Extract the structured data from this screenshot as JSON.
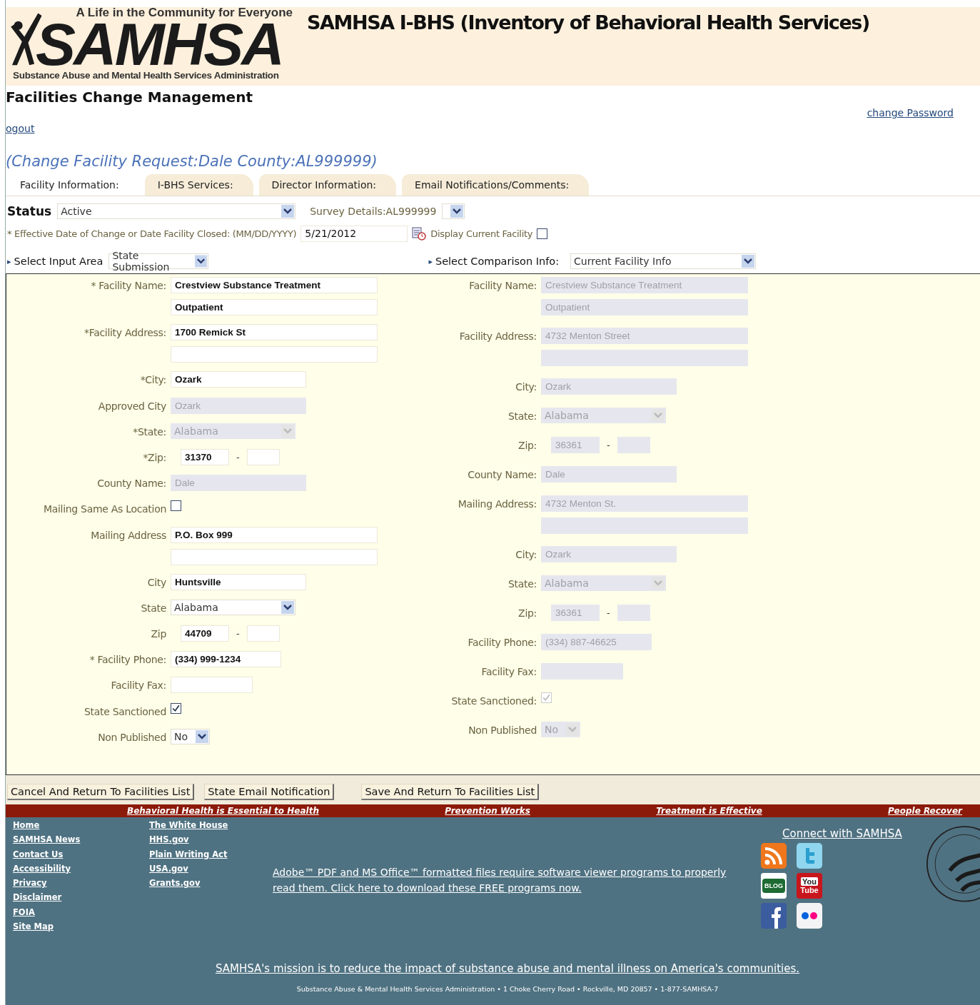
{
  "logo": {
    "tagline": "A Life in the Community for Everyone",
    "wordmark": "SAMHSA",
    "subtitle": "Substance Abuse and Mental Health Services Administration"
  },
  "site_title": "SAMHSA I-BHS (Inventory of Behavioral Health Services)",
  "page_title": "Facilities Change Management",
  "change_password": "change Password",
  "logout": "ogout",
  "request_title": "(Change Facility Request:Dale County:AL999999)",
  "tabs": [
    {
      "label": "Facility Information:",
      "selected": true
    },
    {
      "label": "I-BHS Services:",
      "selected": false
    },
    {
      "label": "Director Information:",
      "selected": false
    },
    {
      "label": "Email Notifications/Comments:",
      "selected": false
    }
  ],
  "status": {
    "label": "Status",
    "value": "Active",
    "survey_label": "Survey Details:AL999999"
  },
  "effective_date": {
    "label": "* Effective Date of Change or Date Facility Closed: (MM/DD/YYYY)",
    "value": "5/21/2012",
    "display_label": "Display Current Facility",
    "display_checked": false
  },
  "input_area": {
    "marker": "▸",
    "label": "Select Input Area",
    "value": "State Submission"
  },
  "comparison": {
    "marker": "▸",
    "label": "Select Comparison Info:",
    "value": "Current Facility Info"
  },
  "form": {
    "columns": [
      {
        "rows": [
          {
            "kind": "wide",
            "label": "* Facility Name:",
            "value": "Crestview Substance Treatment",
            "value_2": "Outpatient",
            "disabled": false
          },
          {
            "kind": "wide",
            "label": "*Facility Address:",
            "value": "1700 Remick St",
            "extra_line": true,
            "disabled": false
          },
          {
            "kind": "medium",
            "label": "*City:",
            "value": "Ozark",
            "disabled": false
          },
          {
            "kind": "medium",
            "label": "Approved City",
            "value": "Ozark",
            "disabled": true
          },
          {
            "kind": "select",
            "label": "*State:",
            "value": "Alabama",
            "disabled": true
          },
          {
            "kind": "zip",
            "label": "*Zip:",
            "value": "31370",
            "separator": "-",
            "disabled": false
          },
          {
            "kind": "medium",
            "label": "County Name:",
            "value": "Dale",
            "disabled": true
          },
          {
            "kind": "checkbox",
            "label": "Mailing Same As Location",
            "checked": false,
            "disabled": false
          },
          {
            "kind": "wide",
            "label": "Mailing Address",
            "value": "P.O. Box 999",
            "extra_line": true,
            "disabled": false
          },
          {
            "kind": "medium",
            "label": "City",
            "value": "Huntsville",
            "disabled": false
          },
          {
            "kind": "select",
            "label": "State",
            "value": "Alabama",
            "disabled": false
          },
          {
            "kind": "zip",
            "label": "Zip",
            "value": "44709",
            "separator": "-",
            "disabled": false
          },
          {
            "kind": "phone",
            "label": "* Facility Phone:",
            "value": "(334) 999-1234",
            "disabled": false
          },
          {
            "kind": "short",
            "label": "Facility Fax:",
            "disabled": false
          },
          {
            "kind": "checkbox",
            "label": "State Sanctioned",
            "checked": true,
            "disabled": false
          },
          {
            "kind": "select-short",
            "label": "Non Published",
            "value": "No",
            "disabled": false
          }
        ]
      },
      {
        "rows": [
          {
            "kind": "wide",
            "label": "Facility Name:",
            "value": "Crestview Substance Treatment",
            "value_2": "Outpatient",
            "disabled": true
          },
          {
            "kind": "wide",
            "label": "Facility Address:",
            "value": "4732 Menton Street",
            "extra_line": true,
            "disabled": true
          },
          {
            "kind": "medium",
            "label": "City:",
            "value": "Ozark",
            "disabled": true
          },
          {
            "kind": "select",
            "label": "State:",
            "value": "Alabama",
            "disabled": true
          },
          {
            "kind": "zip",
            "label": "Zip:",
            "value": "36361",
            "separator": "-",
            "disabled": true
          },
          {
            "kind": "medium",
            "label": "County Name:",
            "value": "Dale",
            "disabled": true
          },
          {
            "kind": "wide",
            "label": "Mailing Address:",
            "value": "4732 Menton St.",
            "extra_line": true,
            "disabled": true
          },
          {
            "kind": "medium",
            "label": "City:",
            "value": "Ozark",
            "disabled": true
          },
          {
            "kind": "select",
            "label": "State:",
            "value": "Alabama",
            "disabled": true
          },
          {
            "kind": "zip",
            "label": "Zip:",
            "value": "36361",
            "separator": "-",
            "disabled": true
          },
          {
            "kind": "phone",
            "label": "Facility Phone:",
            "value": "(334) 887-46625",
            "disabled": true
          },
          {
            "kind": "short",
            "label": "Facility Fax:",
            "disabled": true
          },
          {
            "kind": "checkbox",
            "label": "State Sanctioned:",
            "checked": true,
            "disabled": true
          },
          {
            "kind": "select-short",
            "label": "Non Published",
            "value": "No",
            "disabled": true
          }
        ]
      }
    ]
  },
  "buttons": [
    "Cancel And Return To Facilities List",
    "State Email Notification",
    "Save And Return To Facilities List"
  ],
  "slogans": [
    "Behavioral Health is Essential to Health",
    "Prevention Works",
    "Treatment is Effective",
    "People Recover"
  ],
  "footer": {
    "links_1": [
      "Home",
      "SAMHSA News",
      "Contact Us",
      "Accessibility",
      "Privacy",
      "Disclaimer",
      "FOIA",
      "Site Map"
    ],
    "links_2": [
      "The White House",
      "HHS.gov",
      "Plain Writing Act",
      "USA.gov",
      "Grants.gov"
    ],
    "software_note": "Adobe™ PDF and MS Office™ formatted files require software viewer programs to properly read them. Click here to download these FREE programs now.",
    "connect": "Connect with SAMHSA",
    "social": [
      {
        "kind": "rss"
      },
      {
        "kind": "twitter"
      },
      {
        "kind": "blog",
        "text": "BLOG"
      },
      {
        "kind": "youtube",
        "text": "You",
        "text_2": "Tube"
      },
      {
        "kind": "facebook"
      },
      {
        "kind": "flickr"
      }
    ],
    "mission": "SAMHSA's mission is to reduce the impact of substance abuse and mental illness on America's communities.",
    "address": "Substance Abuse & Mental Health Services Administration • 1 Choke Cherry Road • Rockville, MD 20857 • 1-877-SAMHSA-7"
  }
}
